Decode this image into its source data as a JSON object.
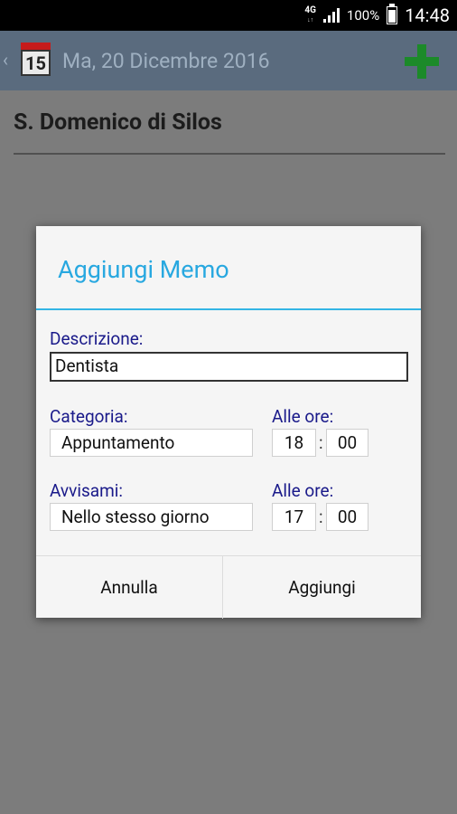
{
  "status": {
    "network": "4G",
    "signal_bars": 4,
    "battery": "100%",
    "time": "14:48"
  },
  "appbar": {
    "back": "‹",
    "calendar_day": "15",
    "date": "Ma, 20 Dicembre 2016",
    "add_icon": "plus-icon"
  },
  "page": {
    "saint": "S. Domenico di Silos"
  },
  "dialog": {
    "title": "Aggiungi Memo",
    "descrizione_label": "Descrizione:",
    "descrizione_value": "Dentista",
    "categoria_label": "Categoria:",
    "categoria_value": "Appuntamento",
    "alle_ore_label": "Alle ore:",
    "time1_hour": "18",
    "time1_minute": "00",
    "avvisami_label": "Avvisami:",
    "avvisami_value": "Nello stesso giorno",
    "alle_ore_label2": "Alle ore:",
    "time2_hour": "17",
    "time2_minute": "00",
    "colon": ":",
    "cancel_label": "Annulla",
    "add_label": "Aggiungi"
  }
}
